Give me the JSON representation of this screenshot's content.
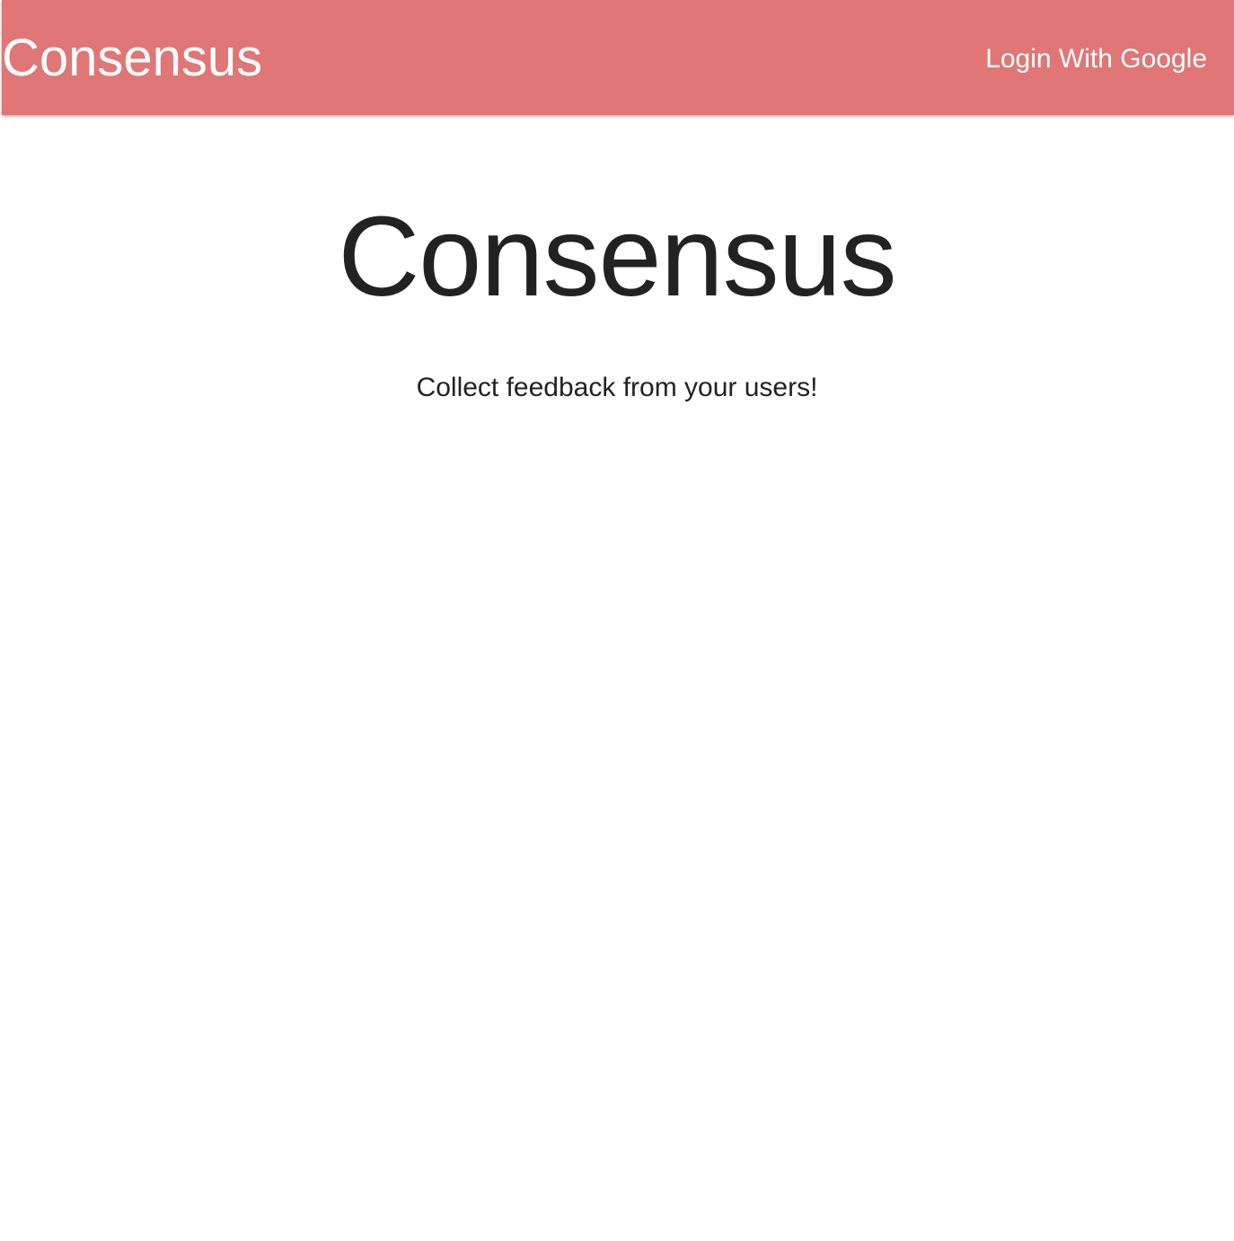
{
  "navbar": {
    "brand": "Consensus",
    "login_link": "Login With Google",
    "background_color": "#e07676"
  },
  "hero": {
    "title": "Consensus",
    "subtitle": "Collect feedback from your users!"
  }
}
